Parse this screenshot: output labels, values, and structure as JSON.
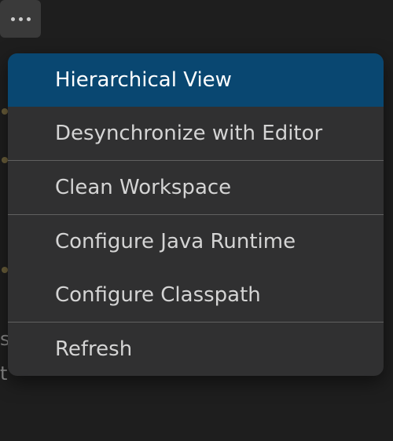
{
  "more_button": {
    "icon": "more-horizontal"
  },
  "menu": {
    "items": [
      {
        "label": "Hierarchical View",
        "selected": true
      },
      {
        "label": "Desynchronize with Editor",
        "selected": false
      },
      {
        "label": "Clean Workspace",
        "selected": false
      },
      {
        "label": "Configure Java Runtime",
        "selected": false
      },
      {
        "label": "Configure Classpath",
        "selected": false
      },
      {
        "label": "Refresh",
        "selected": false
      }
    ]
  },
  "background": {
    "partial_text_1": "s",
    "partial_text_2": "t"
  }
}
